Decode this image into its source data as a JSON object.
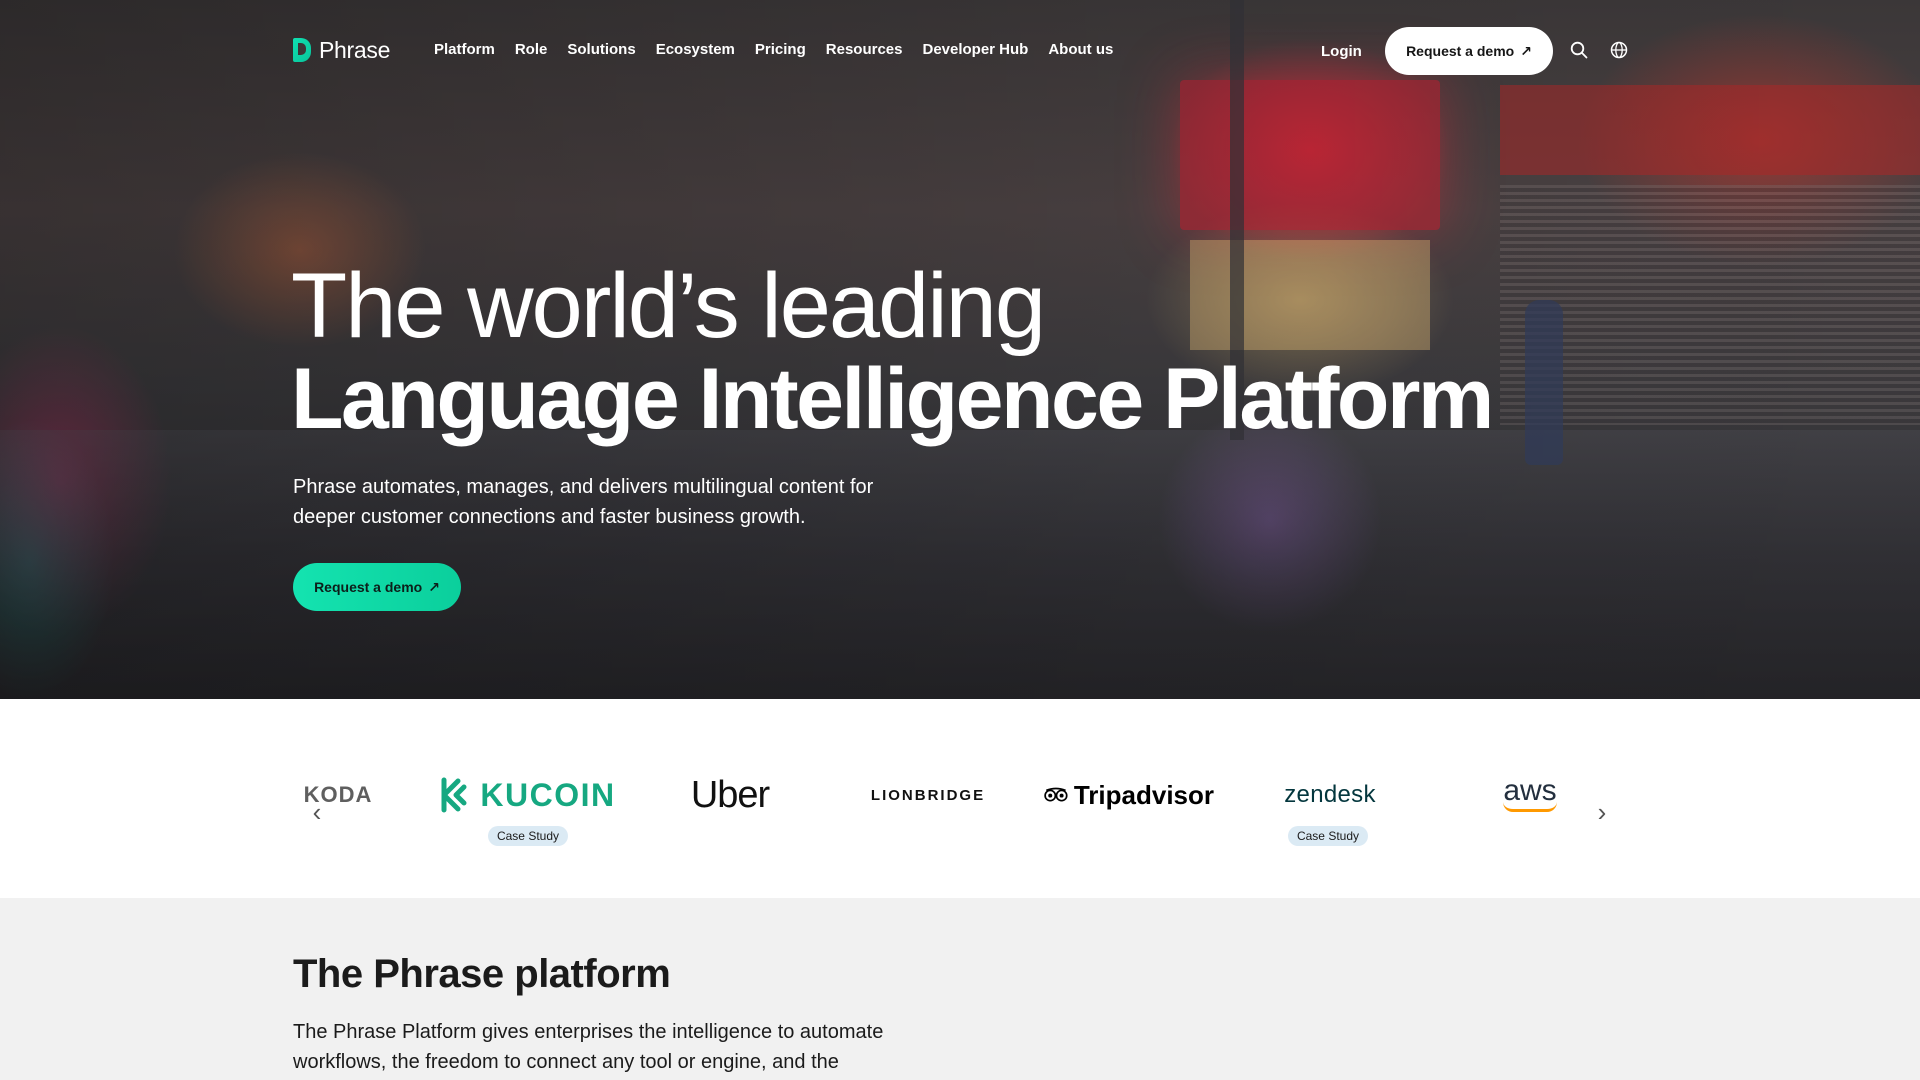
{
  "nav": {
    "logo_text": "Phrase",
    "links": [
      "Platform",
      "Role",
      "Solutions",
      "Ecosystem",
      "Pricing",
      "Resources",
      "Developer Hub",
      "About us"
    ],
    "login": "Login",
    "demo_button": "Request a demo",
    "arrow": "↗",
    "icons": [
      "search-icon",
      "globe-icon"
    ]
  },
  "hero": {
    "title_line1": "The world’s leading",
    "title_line2": "Language Intelligence Platform",
    "subtitle": "Phrase automates, manages, and delivers multilingual content for deeper customer connections and faster business growth.",
    "cta": "Request a demo",
    "arrow": "↗"
  },
  "logos": {
    "brands": [
      "KODA",
      "KUCOIN",
      "Uber",
      "LIONBRIDGE",
      "Tripadvisor",
      "zendesk",
      "aws"
    ],
    "badge": "Case Study",
    "prev": "‹",
    "next": "›"
  },
  "platform": {
    "title": "The Phrase platform",
    "body": "The Phrase Platform gives enterprises the intelligence to automate workflows, the freedom to connect any tool or engine, and the"
  },
  "colors": {
    "accent": "#14e3b0",
    "badge_bg": "#dbeaf4",
    "section_bg": "#f1f1f1"
  }
}
